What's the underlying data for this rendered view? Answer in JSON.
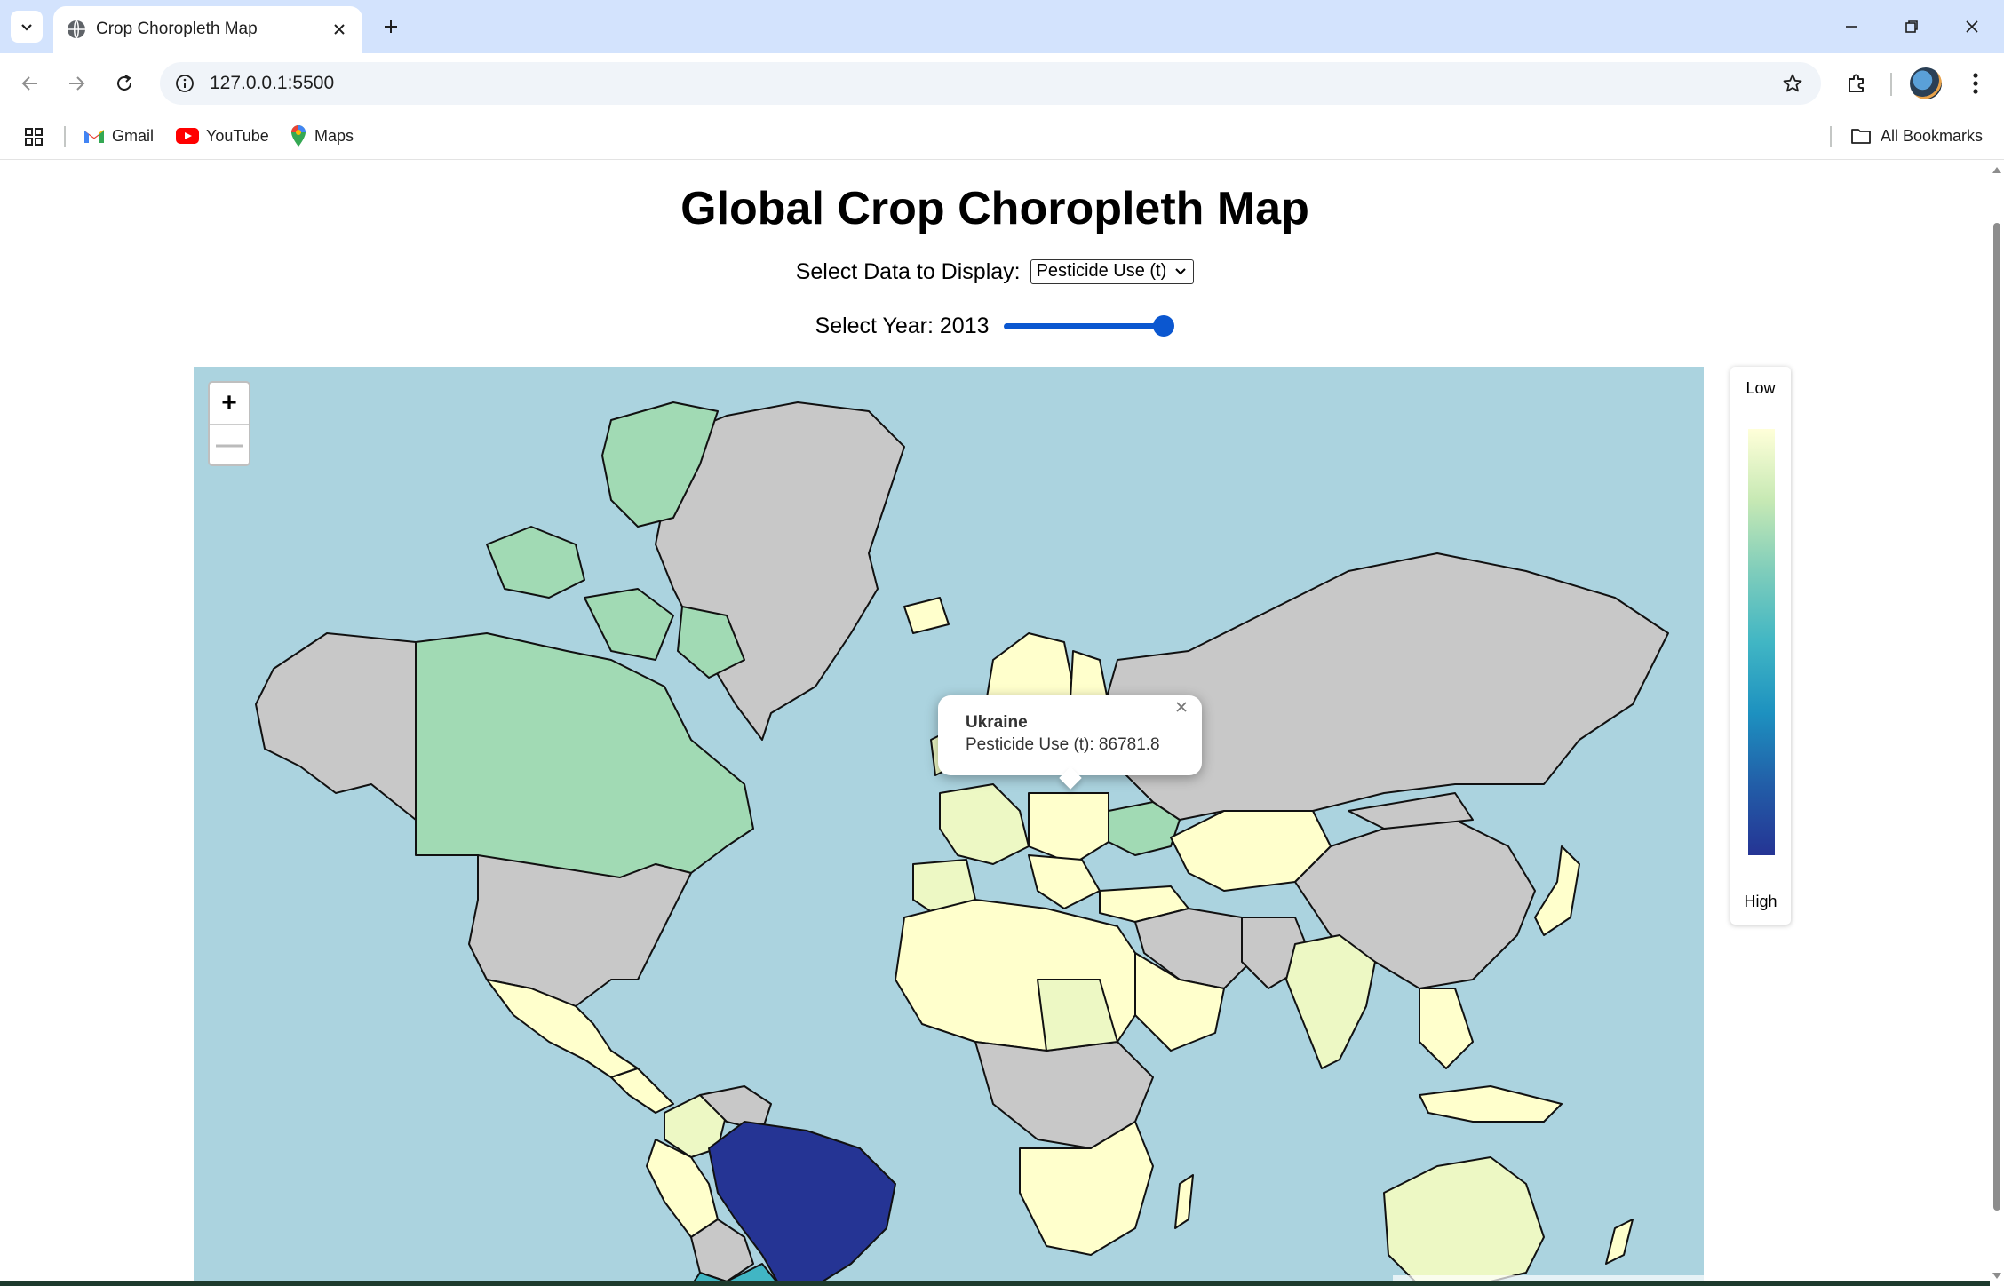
{
  "browser": {
    "tab_title": "Crop Choropleth Map",
    "url": "127.0.0.1:5500",
    "bookmarks": [
      {
        "label": "Gmail"
      },
      {
        "label": "YouTube"
      },
      {
        "label": "Maps"
      }
    ],
    "all_bookmarks_label": "All Bookmarks"
  },
  "page": {
    "title": "Global Crop Choropleth Map",
    "data_select_label": "Select Data to Display:",
    "data_select_value": "Pesticide Use (t)",
    "year_label": "Select Year: 2013",
    "year_value": 2013,
    "year_slider_fraction": 1.0
  },
  "map": {
    "zoom_in": "+",
    "zoom_out": "—",
    "popup": {
      "country": "Ukraine",
      "text": "Pesticide Use (t): 86781.8"
    },
    "colors": {
      "ocean": "#abd3df",
      "no_data": "#c8c8c8",
      "scale": [
        "#ffffcc",
        "#edf8c4",
        "#a1dab4",
        "#41b6c4",
        "#2c7fb8",
        "#253494"
      ]
    }
  },
  "legend": {
    "low_label": "Low",
    "high_label": "High"
  }
}
